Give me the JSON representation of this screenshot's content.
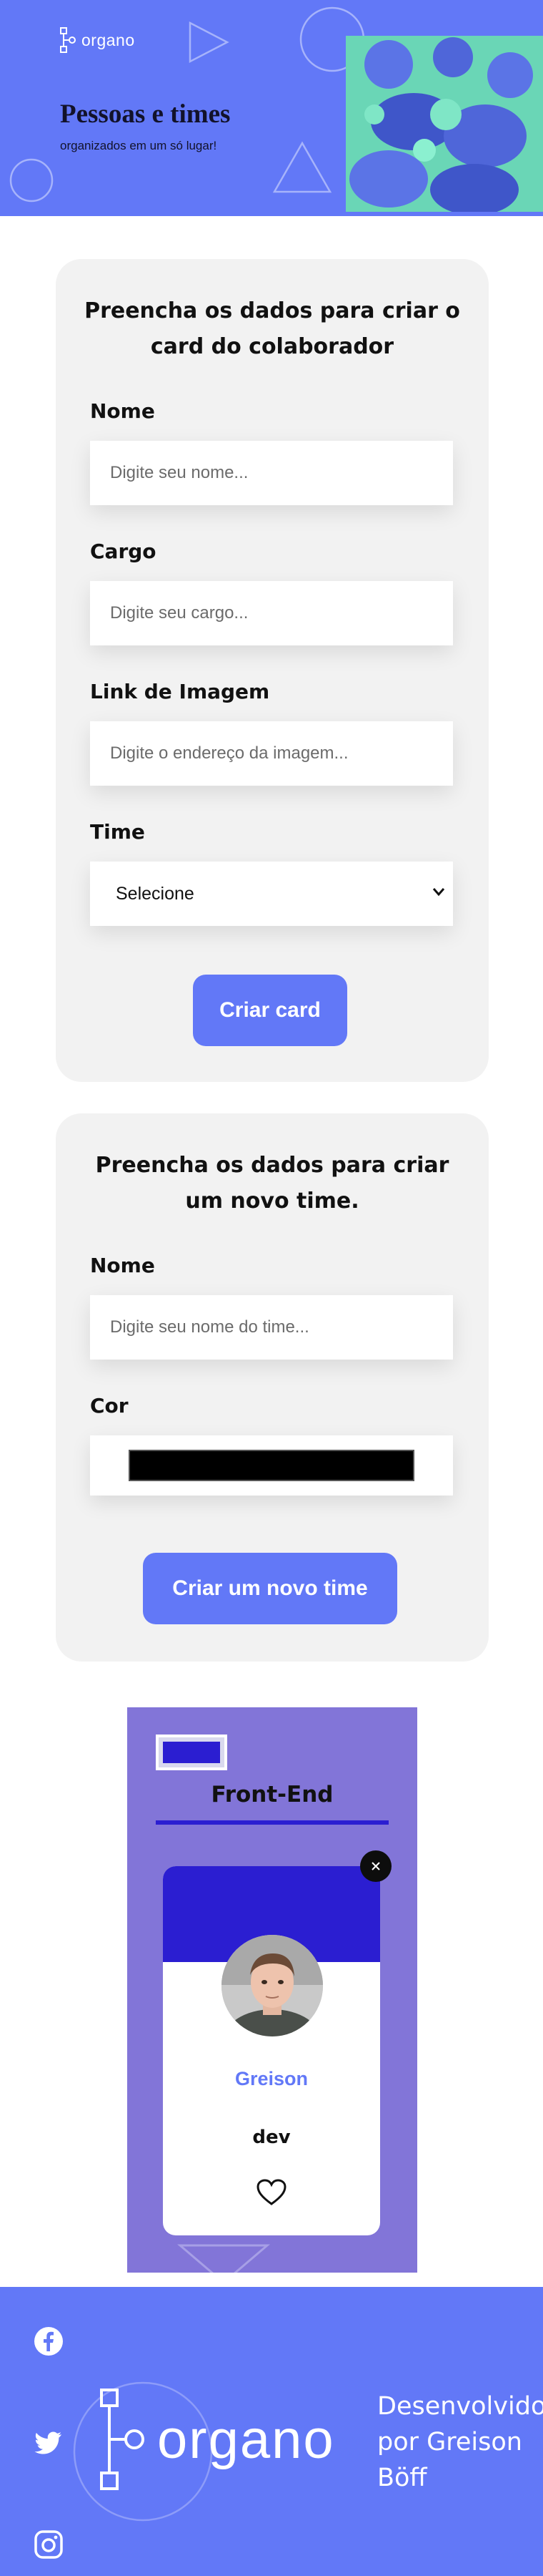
{
  "header": {
    "logo_text": "organo",
    "title": "Pessoas e times",
    "subtitle": "organizados em um só lugar!"
  },
  "collaborator_form": {
    "heading": "Preencha os dados para criar o card do colaborador",
    "fields": [
      {
        "label": "Nome",
        "placeholder": "Digite seu nome..."
      },
      {
        "label": "Cargo",
        "placeholder": "Digite seu cargo..."
      },
      {
        "label": "Link de Imagem",
        "placeholder": "Digite o endereço da imagem..."
      }
    ],
    "team_select": {
      "label": "Time",
      "selected": "Selecione"
    },
    "submit_label": "Criar card"
  },
  "team_form": {
    "heading": "Preencha os dados para criar um novo time.",
    "name_field": {
      "label": "Nome",
      "placeholder": "Digite seu nome do time..."
    },
    "color_field": {
      "label": "Cor",
      "value": "#000000"
    },
    "submit_label": "Criar um novo time"
  },
  "teams": [
    {
      "name": "Front-End",
      "primary_color": "#2b1ed1",
      "background_color": "#8275d8",
      "members": [
        {
          "name": "Greison",
          "role": "dev",
          "favorited": false
        }
      ]
    }
  ],
  "footer": {
    "logo_text": "organo",
    "credit": "Desenvolvido por Greison Böff",
    "social": [
      "facebook-icon",
      "twitter-icon",
      "instagram-icon"
    ]
  },
  "colors": {
    "brand": "#6278f7",
    "form_background": "#f2f2f2",
    "team_primary": "#2b1ed1"
  }
}
